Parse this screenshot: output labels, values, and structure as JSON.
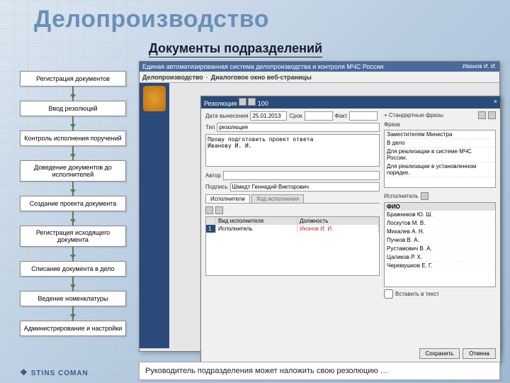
{
  "title_main": "Делопроизводство",
  "title_sub": "Документы подразделений",
  "steps": [
    "Регистрация документов",
    "Ввод резолюций",
    "Контроль исполнения поручений",
    "Доведение документов до исполнителей",
    "Создание проекта документа",
    "Регистрация исходящего документа",
    "Списание документа в дело",
    "Ведение номенклатуры",
    "Администрирование и настройки"
  ],
  "brand": "STINS COMAN",
  "app": {
    "system_title": "Единая автоматизированная система делопроизводства и контроля МЧС России",
    "user": "Иванов И. И.",
    "breadcrumb": "Делопроизводство",
    "page": "Диалоговое окно веб-страницы"
  },
  "dialog": {
    "title": "Резолюция",
    "zoom": "100",
    "close": "×",
    "date_lbl": "Дата вынесения",
    "date_val": "25.01.2013",
    "deadline_lbl": "Срок",
    "fact_lbl": "Факт",
    "type_lbl": "Тип",
    "type_val": "резолюция",
    "text_prefix": "Прошу подготовить проект ответа\nИванову И. И.",
    "std_phrases_lbl": "Стандартные фразы",
    "phrase_cat_lbl": "Фраза",
    "phrases": [
      "Заместителям Министра",
      "В дело",
      "Для реализации в системе МЧС России.",
      "Для реализации в установленном порядке."
    ],
    "tabs": {
      "exec": "Исполнители",
      "progress": "Ход исполнения"
    },
    "author_lbl": "Автор",
    "podpis_lbl": "Подпись",
    "signer": "Шмидт Геннадий Викторович",
    "exec_col1": "Вид исполнителя",
    "exec_col2": "Должность",
    "exec_row_kind": "Исполнитель",
    "exec_row_name": "Иконов И. И.",
    "names_hdr": "Исполнитель",
    "fio_hdr": "ФИО",
    "names": [
      "Бражников Ю. Ш.",
      "Лоскутов М. В.",
      "Михалев А. Н.",
      "Пучков В. А.",
      "Рустамович В. А.",
      "Цаликов Р. Х.",
      "Черемушков Е. Г."
    ],
    "insert_lbl": "Вставить в текст",
    "save_btn": "Сохранить",
    "cancel_btn": "Отмена"
  },
  "caption": "Руководитель подразделения может наложить свою резолюцию …"
}
